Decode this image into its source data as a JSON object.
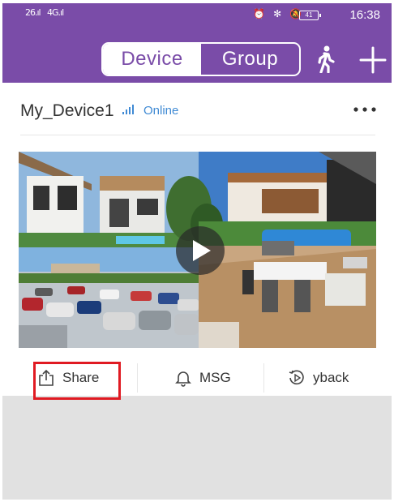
{
  "status_bar": {
    "signal_1": "26.ıl",
    "signal_2": "4G.ıl",
    "icons": "⏰ ✻ 🔕",
    "battery": "41",
    "time": "16:38"
  },
  "header": {
    "tabs": [
      {
        "label": "Device",
        "active": true
      },
      {
        "label": "Group",
        "active": false
      }
    ],
    "walk_icon": "person-walking-icon",
    "add_icon": "plus-icon",
    "color": "#7a4ca8"
  },
  "device": {
    "name": "My_Device1",
    "status": "Online",
    "status_color": "#3f8ad4"
  },
  "actions": {
    "share": "Share",
    "msg": "MSG",
    "playback": "yback"
  },
  "highlight_color": "#e01a22"
}
